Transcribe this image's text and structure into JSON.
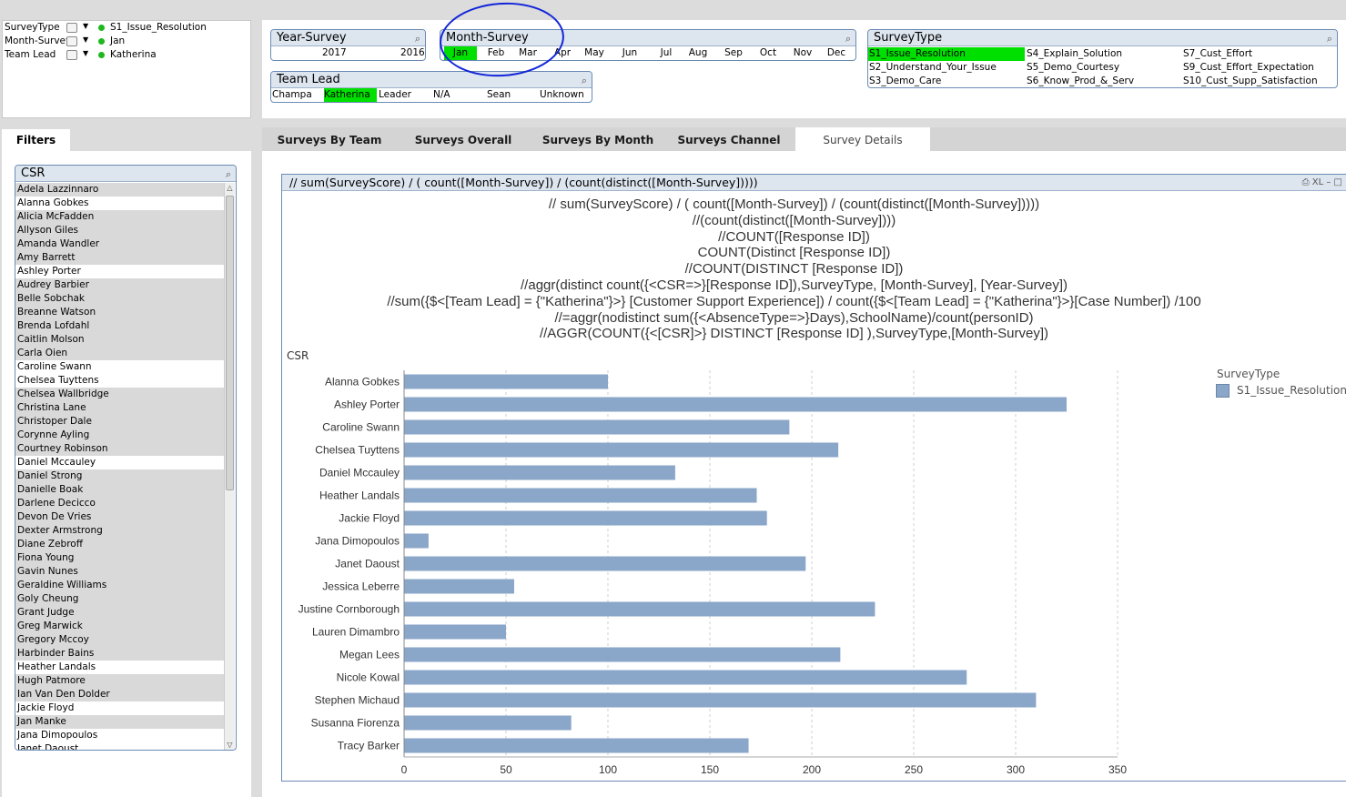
{
  "current_selections": [
    {
      "field": "SurveyType",
      "value": "S1_Issue_Resolution"
    },
    {
      "field": "Month-Survey",
      "value": "Jan"
    },
    {
      "field": "Team Lead",
      "value": "Katherina"
    }
  ],
  "year_survey": {
    "title": "Year-Survey",
    "values": [
      "2017",
      "2016"
    ]
  },
  "month_survey": {
    "title": "Month-Survey",
    "values": [
      "Jan",
      "Feb",
      "Mar",
      "Apr",
      "May",
      "Jun",
      "Jul",
      "Aug",
      "Sep",
      "Oct",
      "Nov",
      "Dec"
    ],
    "selected": "Jan"
  },
  "team_lead": {
    "title": "Team Lead",
    "values": [
      "Champa",
      "Katherina",
      "Leader",
      "N/A",
      "Sean",
      "Unknown"
    ],
    "selected": "Katherina"
  },
  "survey_type": {
    "title": "SurveyType",
    "values": [
      "S1_Issue_Resolution",
      "S4_Explain_Solution",
      "S7_Cust_Effort",
      "S2_Understand_Your_Issue",
      "S5_Demo_Courtesy",
      "S9_Cust_Effort_Expectation",
      "S3_Demo_Care",
      "S6_Know_Prod_&_Serv",
      "S10_Cust_Supp_Satisfaction"
    ],
    "selected": "S1_Issue_Resolution"
  },
  "filters_tab": "Filters",
  "csr_list": {
    "title": "CSR",
    "items": [
      {
        "name": "Adela Lazzinnaro",
        "state": "ex"
      },
      {
        "name": "Alanna Gobkes",
        "state": "po"
      },
      {
        "name": "Alicia McFadden",
        "state": "ex"
      },
      {
        "name": "Allyson Giles",
        "state": "ex"
      },
      {
        "name": "Amanda Wandler",
        "state": "ex"
      },
      {
        "name": "Amy Barrett",
        "state": "ex"
      },
      {
        "name": "Ashley Porter",
        "state": "po"
      },
      {
        "name": "Audrey Barbier",
        "state": "ex"
      },
      {
        "name": "Belle Sobchak",
        "state": "ex"
      },
      {
        "name": "Breanne Watson",
        "state": "ex"
      },
      {
        "name": "Brenda Lofdahl",
        "state": "ex"
      },
      {
        "name": "Caitlin Molson",
        "state": "ex"
      },
      {
        "name": "Carla Oien",
        "state": "ex"
      },
      {
        "name": "Caroline Swann",
        "state": "po"
      },
      {
        "name": "Chelsea Tuyttens",
        "state": "po"
      },
      {
        "name": "Chelsea Wallbridge",
        "state": "ex"
      },
      {
        "name": "Christina Lane",
        "state": "ex"
      },
      {
        "name": "Christoper Dale",
        "state": "ex"
      },
      {
        "name": "Corynne Ayling",
        "state": "ex"
      },
      {
        "name": "Courtney Robinson",
        "state": "ex"
      },
      {
        "name": "Daniel Mccauley",
        "state": "po"
      },
      {
        "name": "Daniel Strong",
        "state": "ex"
      },
      {
        "name": "Danielle Boak",
        "state": "ex"
      },
      {
        "name": "Darlene Decicco",
        "state": "ex"
      },
      {
        "name": "Devon De Vries",
        "state": "ex"
      },
      {
        "name": "Dexter Armstrong",
        "state": "ex"
      },
      {
        "name": "Diane Zebroff",
        "state": "ex"
      },
      {
        "name": "Fiona Young",
        "state": "ex"
      },
      {
        "name": "Gavin Nunes",
        "state": "ex"
      },
      {
        "name": "Geraldine Williams",
        "state": "ex"
      },
      {
        "name": "Goly Cheung",
        "state": "ex"
      },
      {
        "name": "Grant Judge",
        "state": "ex"
      },
      {
        "name": "Greg Marwick",
        "state": "ex"
      },
      {
        "name": "Gregory Mccoy",
        "state": "ex"
      },
      {
        "name": "Harbinder Bains",
        "state": "ex"
      },
      {
        "name": "Heather Landals",
        "state": "po"
      },
      {
        "name": "Hugh Patmore",
        "state": "ex"
      },
      {
        "name": "Ian Van Den Dolder",
        "state": "ex"
      },
      {
        "name": "Jackie Floyd",
        "state": "po"
      },
      {
        "name": "Jan Manke",
        "state": "ex"
      },
      {
        "name": "Jana Dimopoulos",
        "state": "po"
      },
      {
        "name": "Janet Daoust",
        "state": "po"
      }
    ]
  },
  "tabs": [
    {
      "label": "Surveys By Team"
    },
    {
      "label": "Surveys Overall"
    },
    {
      "label": "Surveys By Month"
    },
    {
      "label": "Surveys Channel"
    },
    {
      "label": "Survey Details"
    }
  ],
  "chart_caption": "// sum(SurveyScore) / ( count([Month-Survey]) / (count(distinct([Month-Survey]))))",
  "caption_icons": "XL",
  "formulas": [
    "// sum(SurveyScore) / ( count([Month-Survey]) / (count(distinct([Month-Survey]))))",
    "//(count(distinct([Month-Survey])))",
    "//COUNT([Response ID])",
    "COUNT(Distinct [Response ID])",
    "//COUNT(DISTINCT [Response ID])",
    "//aggr(distinct count({<CSR=>}[Response ID]),SurveyType, [Month-Survey], [Year-Survey])",
    "//sum({$<[Team Lead] = {\"Katherina\"}>} [Customer Support Experience]) / count({$<[Team Lead] = {\"Katherina\"}>}[Case Number]) /100",
    "//=aggr(nodistinct sum({<AbsenceType=>}Days),SchoolName)/count(personID)",
    "//AGGR(COUNT({<[CSR]>} DISTINCT [Response ID] ),SurveyType,[Month-Survey])"
  ],
  "chart_data": {
    "type": "bar",
    "orientation": "horizontal",
    "dimension_label": "CSR",
    "categories": [
      "Alanna Gobkes",
      "Ashley Porter",
      "Caroline Swann",
      "Chelsea Tuyttens",
      "Daniel Mccauley",
      "Heather Landals",
      "Jackie Floyd",
      "Jana Dimopoulos",
      "Janet Daoust",
      "Jessica Leberre",
      "Justine Cornborough",
      "Lauren Dimambro",
      "Megan Lees",
      "Nicole Kowal",
      "Stephen Michaud",
      "Susanna Fiorenza",
      "Tracy Barker"
    ],
    "series": [
      {
        "name": "S1_Issue_Resolution",
        "values": [
          100,
          325,
          189,
          213,
          133,
          173,
          178,
          12,
          197,
          54,
          231,
          50,
          214,
          276,
          310,
          82,
          169
        ]
      }
    ],
    "legend_title": "SurveyType",
    "xlim": [
      0,
      350
    ],
    "xticks": [
      0,
      50,
      100,
      150,
      200,
      250,
      300,
      350
    ],
    "grid": true,
    "bar_color": "#8aa6c9"
  }
}
